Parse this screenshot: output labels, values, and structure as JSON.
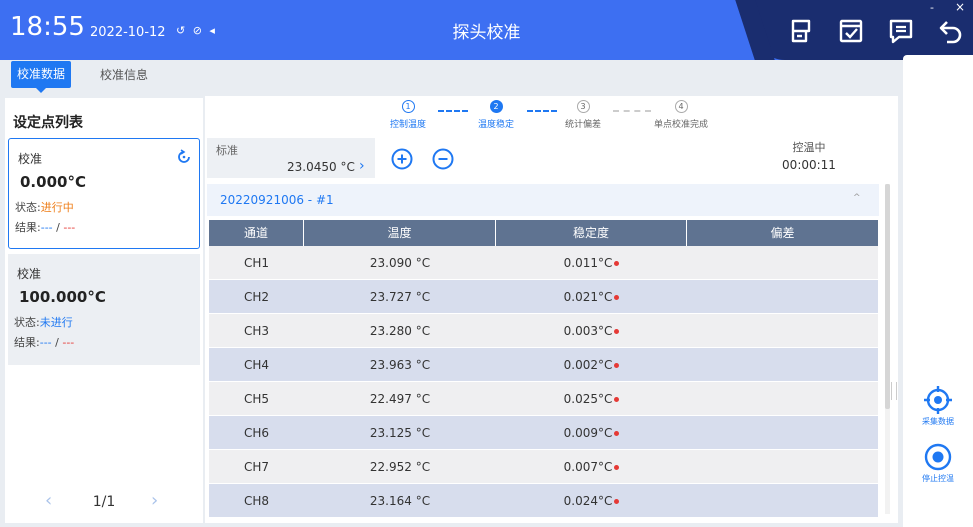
{
  "header": {
    "time": "18:55",
    "date": "2022-10-12",
    "status_icons": "↺ ⊘ ◂",
    "title": "探头校准",
    "window_min": "-",
    "window_close": "×"
  },
  "tabs": [
    {
      "label": "校准数据",
      "active": true
    },
    {
      "label": "校准信息",
      "active": false
    }
  ],
  "left": {
    "title": "设定点列表",
    "cards": [
      {
        "name": "校准",
        "value": "0.000°C",
        "state_label": "状态:",
        "state": "进行中",
        "result_label": "结果:",
        "result_a": "---",
        "sep": " / ",
        "result_b": "---"
      },
      {
        "name": "校准",
        "value": "100.000°C",
        "state_label": "状态:",
        "state": "未进行",
        "result_label": "结果:",
        "result_a": "---",
        "sep": " / ",
        "result_b": "---"
      }
    ],
    "pager": {
      "text": "1/1",
      "prev": "‹",
      "next": "›"
    }
  },
  "stepper": {
    "current_step": 2,
    "steps": [
      {
        "num": "1",
        "label": "控制温度"
      },
      {
        "num": "2",
        "label": "温度稳定"
      },
      {
        "num": "3",
        "label": "统计偏差"
      },
      {
        "num": "4",
        "label": "单点校准完成"
      }
    ]
  },
  "standard": {
    "label": "标准",
    "value": "23.0450 °C",
    "arrow": "›"
  },
  "control": {
    "label": "控温中",
    "time": "00:00:11"
  },
  "group": {
    "title": "20220921006 - #1",
    "caret": "^"
  },
  "table": {
    "columns": [
      "通道",
      "温度",
      "稳定度",
      "偏差"
    ],
    "rows": [
      {
        "ch": "CH1",
        "temp": "23.090 °C",
        "stab": "0.011°C",
        "dev": ""
      },
      {
        "ch": "CH2",
        "temp": "23.727 °C",
        "stab": "0.021°C",
        "dev": ""
      },
      {
        "ch": "CH3",
        "temp": "23.280 °C",
        "stab": "0.003°C",
        "dev": ""
      },
      {
        "ch": "CH4",
        "temp": "23.963 °C",
        "stab": "0.002°C",
        "dev": ""
      },
      {
        "ch": "CH5",
        "temp": "22.497 °C",
        "stab": "0.025°C",
        "dev": ""
      },
      {
        "ch": "CH6",
        "temp": "23.125 °C",
        "stab": "0.009°C",
        "dev": ""
      },
      {
        "ch": "CH7",
        "temp": "22.952 °C",
        "stab": "0.007°C",
        "dev": ""
      },
      {
        "ch": "CH8",
        "temp": "23.164 °C",
        "stab": "0.024°C",
        "dev": ""
      }
    ]
  },
  "right": {
    "collect_label": "采集数据",
    "stop_label": "停止控温"
  },
  "icons": {
    "header": [
      "report-icon",
      "checkbox-icon",
      "message-icon",
      "back-icon"
    ],
    "main": [
      "add-circle-icon",
      "remove-circle-icon",
      "refresh-icon"
    ],
    "right": [
      "crosshair-icon",
      "stop-icon"
    ]
  },
  "colors": {
    "header": "#3d6ff2",
    "header_dark": "#1a2d6f",
    "accent": "#1f78f2",
    "table_header": "#5f7391",
    "row_alt": "#d7dded",
    "in_progress": "#ee7d17",
    "alarm": "#e53935"
  }
}
